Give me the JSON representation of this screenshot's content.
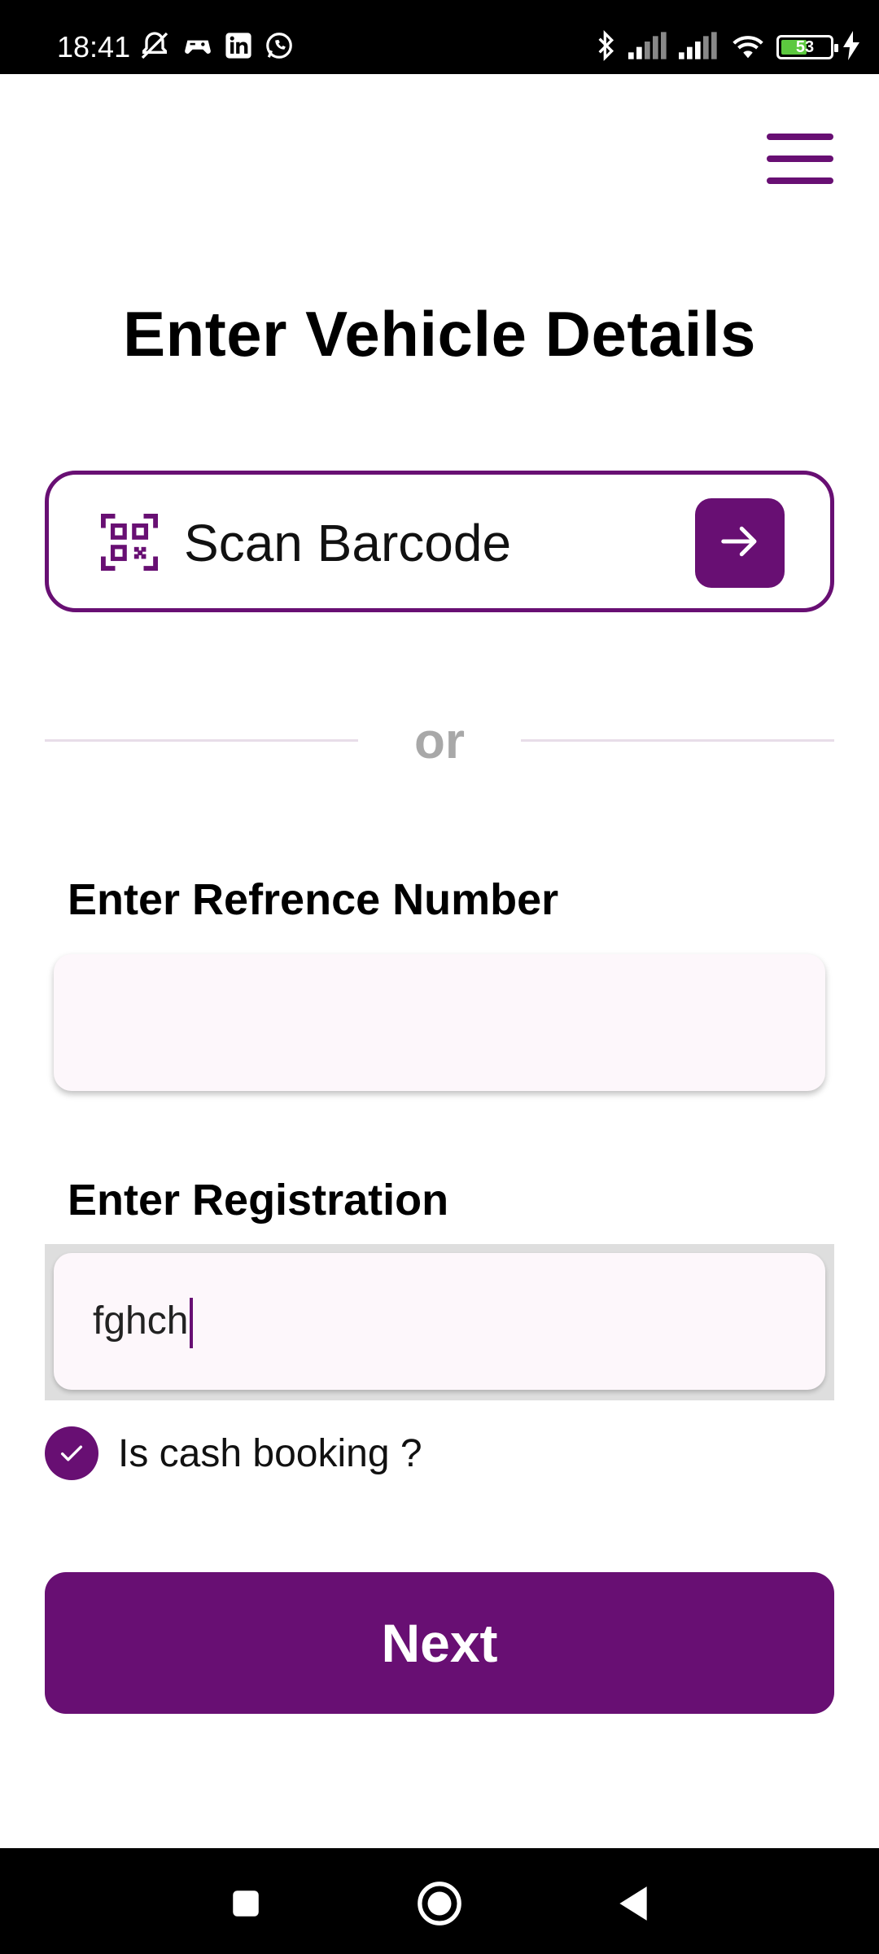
{
  "status_bar": {
    "time": "18:41",
    "battery_level": "53",
    "battery_fraction": 0.53,
    "left_icons": [
      "muted-alarm-icon",
      "game-icon",
      "linkedin-icon",
      "whatsapp-icon"
    ],
    "right_icons": [
      "bluetooth-icon",
      "signal-icon",
      "signal-icon",
      "wifi-icon",
      "battery-icon",
      "charging-icon"
    ]
  },
  "header": {
    "menu_icon": "hamburger-menu-icon"
  },
  "page": {
    "title": "Enter Vehicle Details"
  },
  "scan": {
    "label": "Scan Barcode",
    "icon": "qr-code-icon",
    "action_icon": "arrow-right-icon"
  },
  "divider": {
    "text": "or"
  },
  "reference_field": {
    "label": "Enter Refrence Number",
    "value": ""
  },
  "registration_field": {
    "label": "Enter Registration",
    "value": "fghch"
  },
  "cash_booking": {
    "label": "Is cash booking ?",
    "checked": true
  },
  "next_button": {
    "label": "Next"
  },
  "navigation_bar": {
    "buttons": [
      "recents-icon",
      "home-icon",
      "back-icon"
    ]
  },
  "colors": {
    "accent": "#680f73",
    "input_bg": "#fdf7fb",
    "muted_text": "#a8a8a8"
  }
}
